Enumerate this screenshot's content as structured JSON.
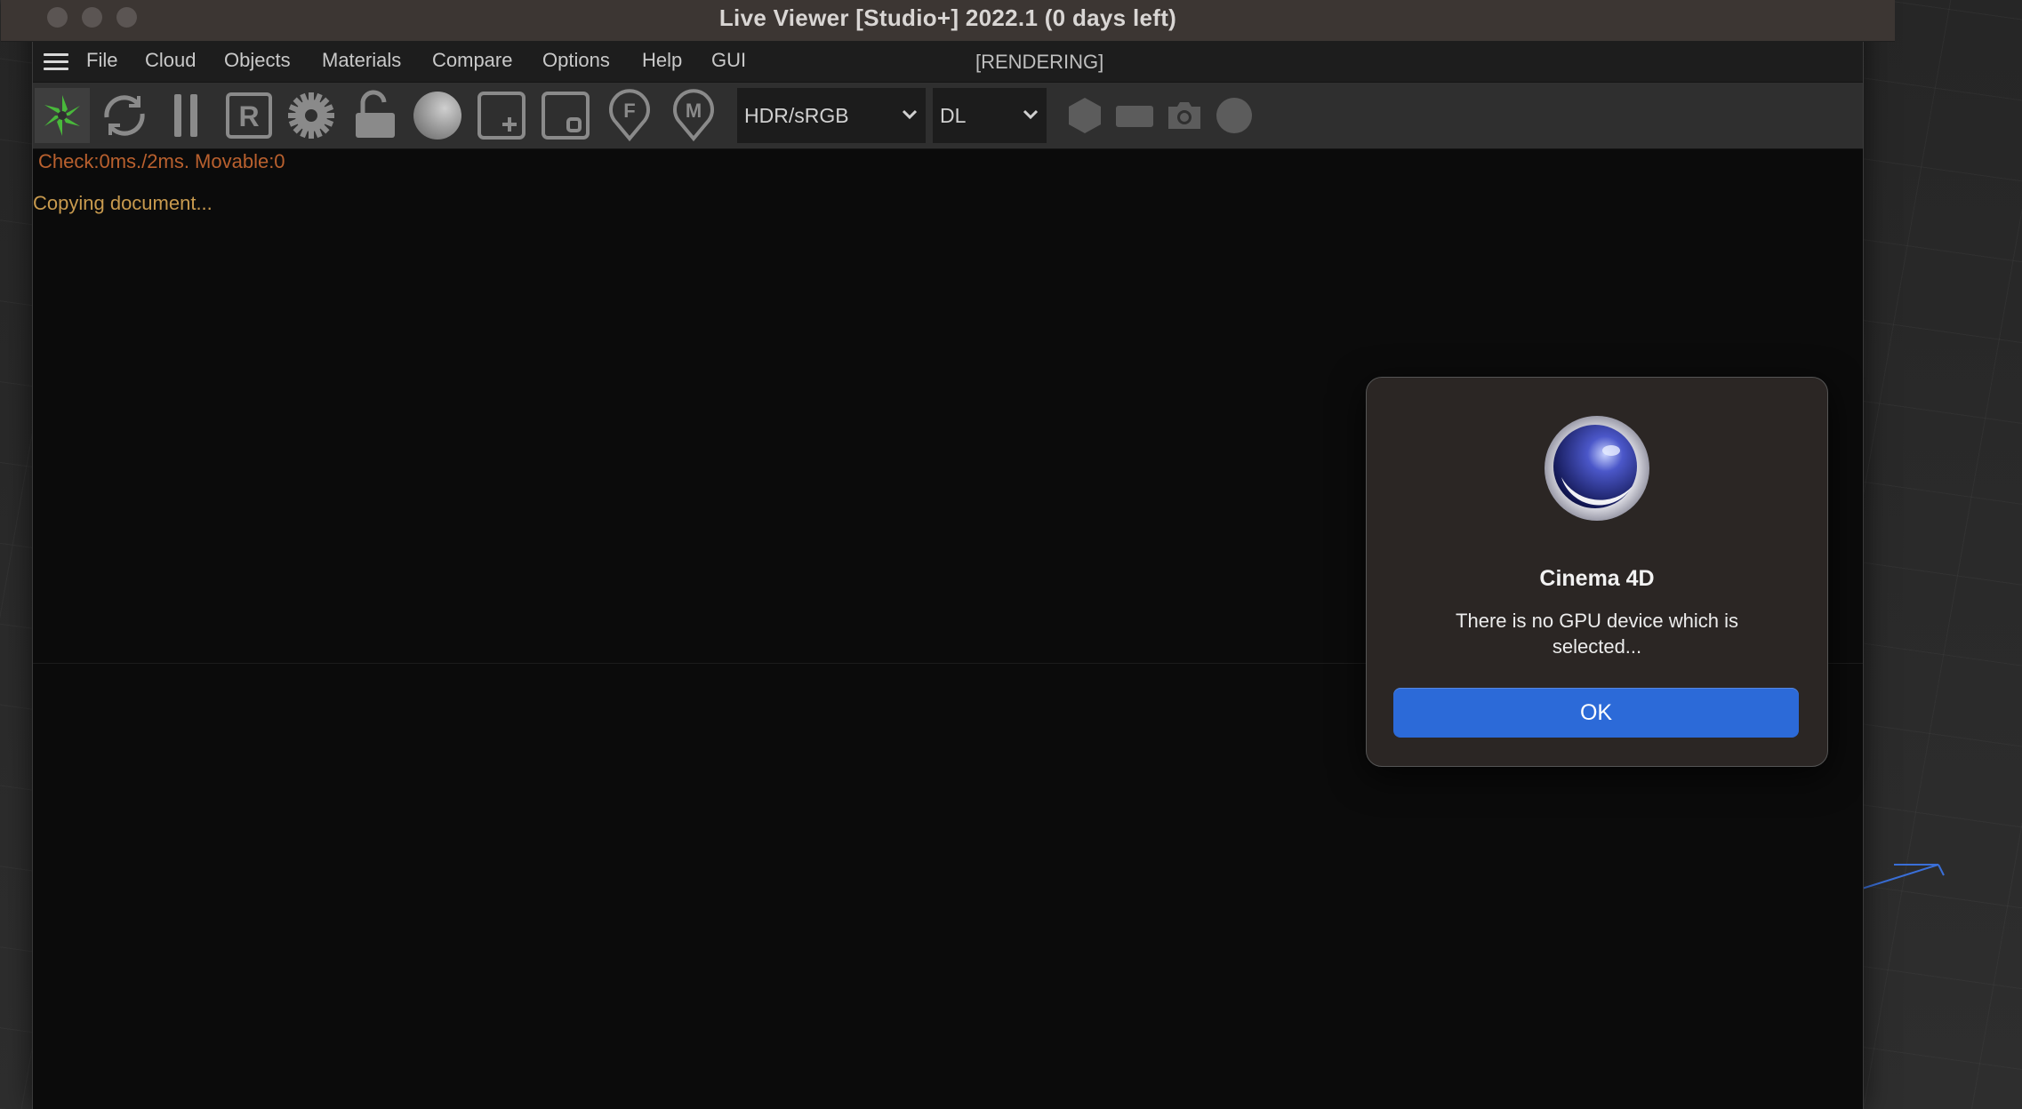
{
  "window": {
    "title": "Live Viewer [Studio+] 2022.1 (0 days left)",
    "render_status": "[RENDERING]"
  },
  "menu": {
    "items": [
      "File",
      "Cloud",
      "Objects",
      "Materials",
      "Compare",
      "Options",
      "Help",
      "GUI"
    ]
  },
  "toolbar": {
    "color_space_select": "HDR/sRGB",
    "mode_select": "DL",
    "icons": [
      "render-start-icon",
      "refresh-icon",
      "pause-icon",
      "region-r-icon",
      "settings-gear-icon",
      "lock-open-icon",
      "sphere-material-icon",
      "add-frame-icon",
      "frame-o-icon",
      "focus-pin-f-icon",
      "material-pin-m-icon",
      "hexagon-icon",
      "rect-icon",
      "camera-icon",
      "circle-icon"
    ]
  },
  "console": {
    "check_line": "Check:0ms./2ms. Movable:0",
    "status_line": "Copying document..."
  },
  "dialog": {
    "app_name": "Cinema 4D",
    "message": "There is no GPU device which is selected...",
    "ok_label": "OK"
  },
  "colors": {
    "accent_button": "#2c6ad8",
    "active_icon_green": "#49b83b",
    "console_orange": "#b9602e"
  }
}
